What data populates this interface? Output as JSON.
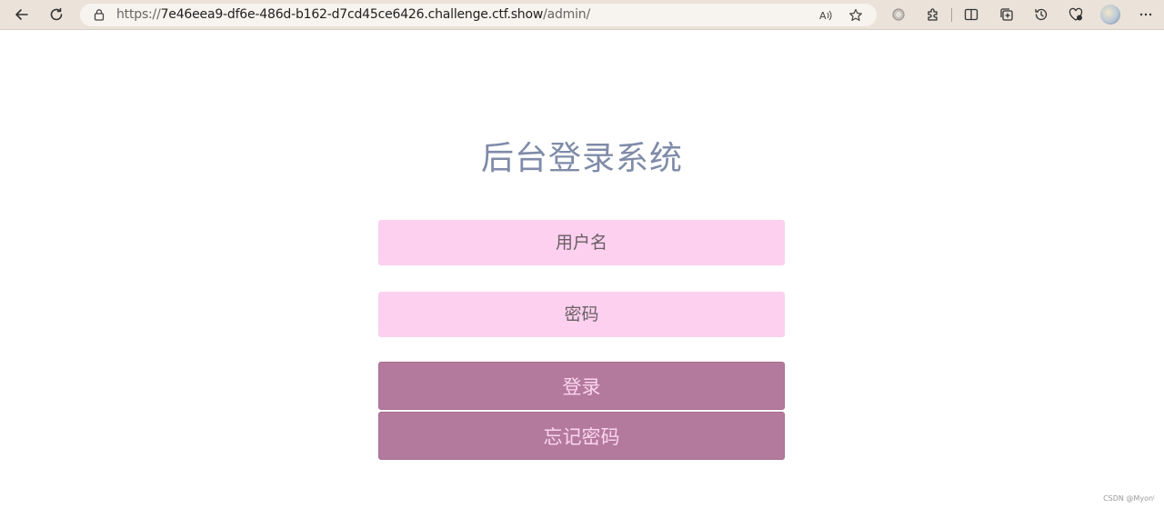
{
  "browser": {
    "url_prefix": "https://",
    "url_host": "7e46eea9-df6e-486d-b162-d7cd45ce6426.challenge.ctf.show",
    "url_path": "/admin/",
    "icons": {
      "back": "arrow-left-icon",
      "refresh": "refresh-icon",
      "lock": "lock-icon",
      "read_aloud": "read-aloud-icon",
      "favorite": "star-icon",
      "extension_circle": "circle-icon",
      "extensions": "puzzle-icon",
      "split_screen": "split-screen-icon",
      "collections": "collections-icon",
      "history": "history-icon",
      "heartbeat": "performance-icon",
      "profile": "avatar-icon",
      "more": "more-icon"
    }
  },
  "page": {
    "title": "后台登录系统",
    "username_placeholder": "用户名",
    "password_placeholder": "密码",
    "login_label": "登录",
    "forgot_label": "忘记密码",
    "watermark": "CSDN @Myon⁽"
  },
  "colors": {
    "title": "#7f8ba8",
    "input_bg": "#fcd0ee",
    "button_bg": "#b37a9d",
    "button_text": "#fcd4ef",
    "toolbar_bg": "#ebe3da"
  }
}
